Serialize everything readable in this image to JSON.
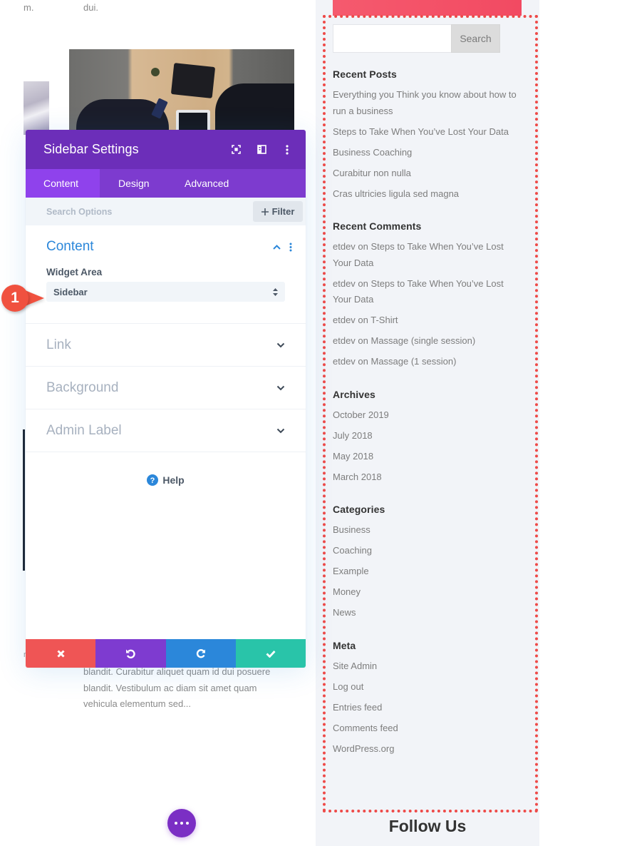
{
  "background": {
    "top_text_left": "m.",
    "top_text_right": "dui.",
    "article_excerpt": "blandit. Curabitur aliquet quam id dui posuere blandit. Vestibulum ac diam sit amet quam vehicula elementum sed...",
    "stray_char": "r"
  },
  "fab": {
    "icon": "more-horizontal-icon"
  },
  "modal": {
    "title": "Sidebar Settings",
    "header_icons": [
      "fullscreen-icon",
      "split-view-icon",
      "more-vertical-icon"
    ],
    "tabs": [
      {
        "label": "Content",
        "active": true
      },
      {
        "label": "Design",
        "active": false
      },
      {
        "label": "Advanced",
        "active": false
      }
    ],
    "search": {
      "placeholder": "Search Options",
      "value": ""
    },
    "filter_label": "Filter",
    "sections": {
      "content": {
        "title": "Content",
        "expanded": true,
        "field_label": "Widget Area",
        "select_value": "Sidebar"
      },
      "collapsed": [
        {
          "title": "Link"
        },
        {
          "title": "Background"
        },
        {
          "title": "Admin Label"
        }
      ]
    },
    "help_label": "Help",
    "actions": [
      {
        "name": "discard",
        "icon": "close-icon",
        "color": "#ef5555"
      },
      {
        "name": "undo",
        "icon": "undo-icon",
        "color": "#7e3bd0"
      },
      {
        "name": "redo",
        "icon": "redo-icon",
        "color": "#2b87da"
      },
      {
        "name": "save",
        "icon": "check-icon",
        "color": "#29c4a9"
      }
    ]
  },
  "step_marker": {
    "number": "1",
    "color": "#f0513f"
  },
  "sidebar": {
    "search_placeholder": "",
    "search_button": "Search",
    "widgets": [
      {
        "title": "Recent Posts",
        "items": [
          "Everything you Think you know about how to run a business",
          "Steps to Take When You’ve Lost Your Data",
          "Business Coaching",
          "Curabitur non nulla",
          "Cras ultricies ligula sed magna"
        ]
      },
      {
        "title": "Recent Comments",
        "items": [
          "etdev on Steps to Take When You’ve Lost Your Data",
          "etdev on Steps to Take When You’ve Lost Your Data",
          "etdev on T-Shirt",
          "etdev on Massage (single session)",
          "etdev on Massage (1 session)"
        ]
      },
      {
        "title": "Archives",
        "items": [
          "October 2019",
          "July 2018",
          "May 2018",
          "March 2018"
        ]
      },
      {
        "title": "Categories",
        "items": [
          "Business",
          "Coaching",
          "Example",
          "Money",
          "News"
        ]
      },
      {
        "title": "Meta",
        "items": [
          "Site Admin",
          "Log out",
          "Entries feed",
          "Comments feed",
          "WordPress.org"
        ]
      }
    ],
    "follow_heading": "Follow Us",
    "highlight_color": "#ee4a48"
  }
}
